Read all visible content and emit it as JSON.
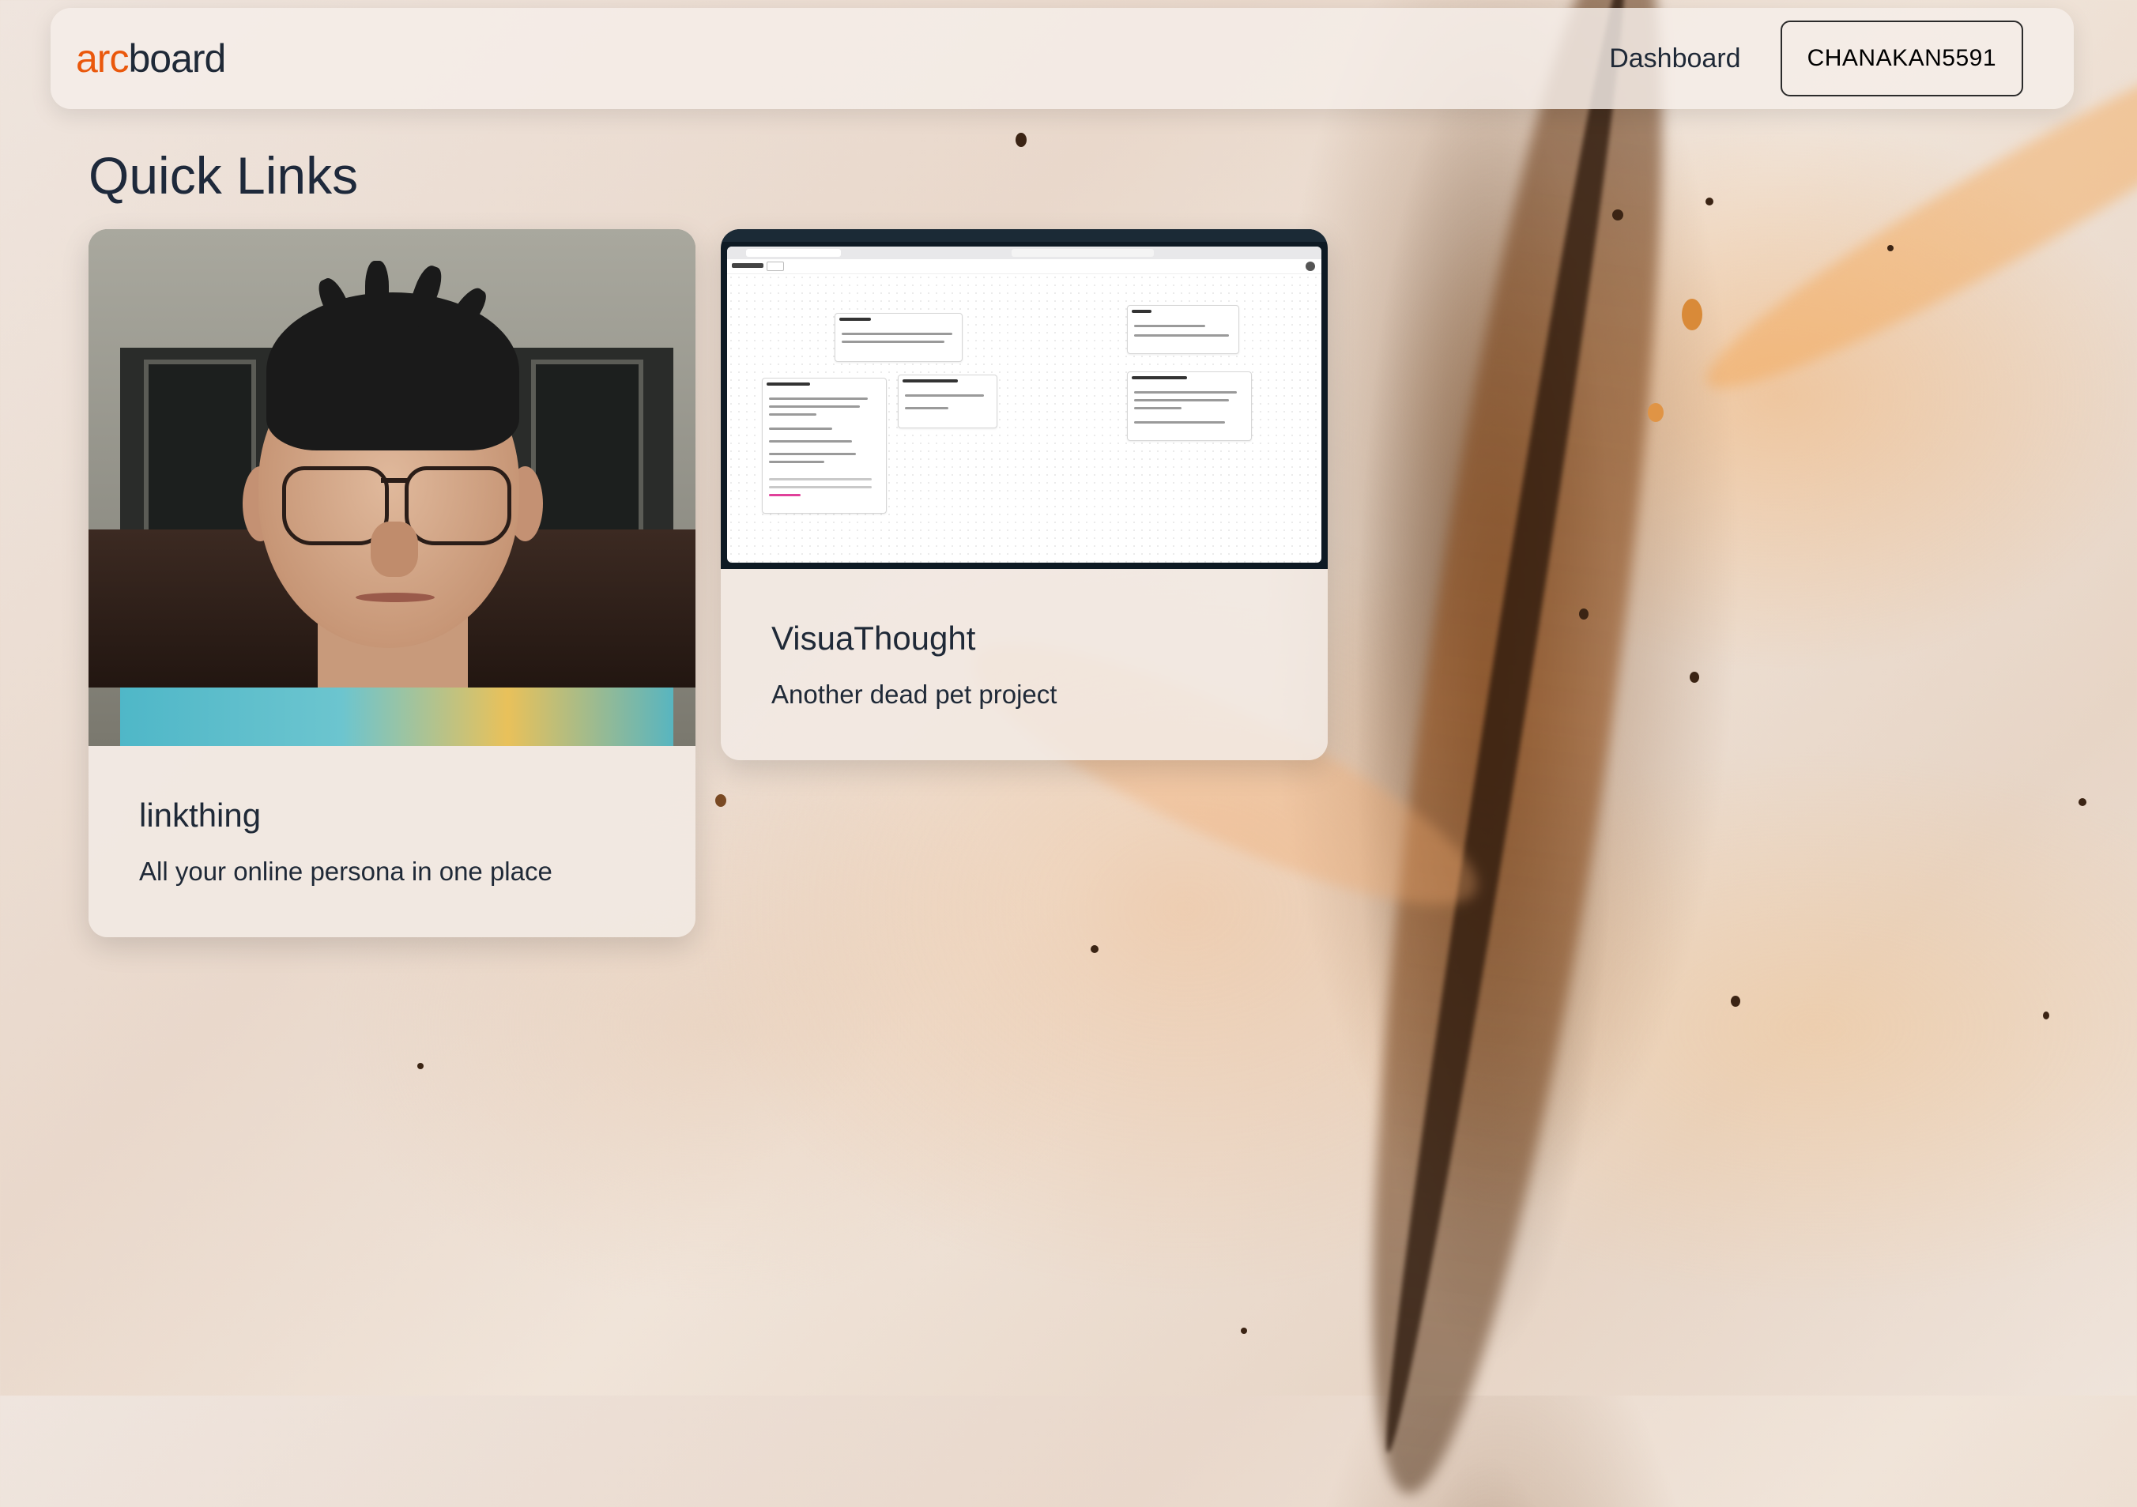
{
  "navbar": {
    "logo_accent": "arc",
    "logo_rest": "board",
    "nav_link": "Dashboard",
    "user_button": "CHANAKAN5591"
  },
  "page": {
    "title": "Quick Links"
  },
  "cards": [
    {
      "title": "linkthing",
      "description": "All your online persona in one place",
      "image": "webcam-portrait"
    },
    {
      "title": "VisuaThought",
      "description": "Another dead pet project",
      "image": "app-screenshot"
    }
  ],
  "colors": {
    "accent": "#ea580c",
    "text": "#1f2937"
  }
}
